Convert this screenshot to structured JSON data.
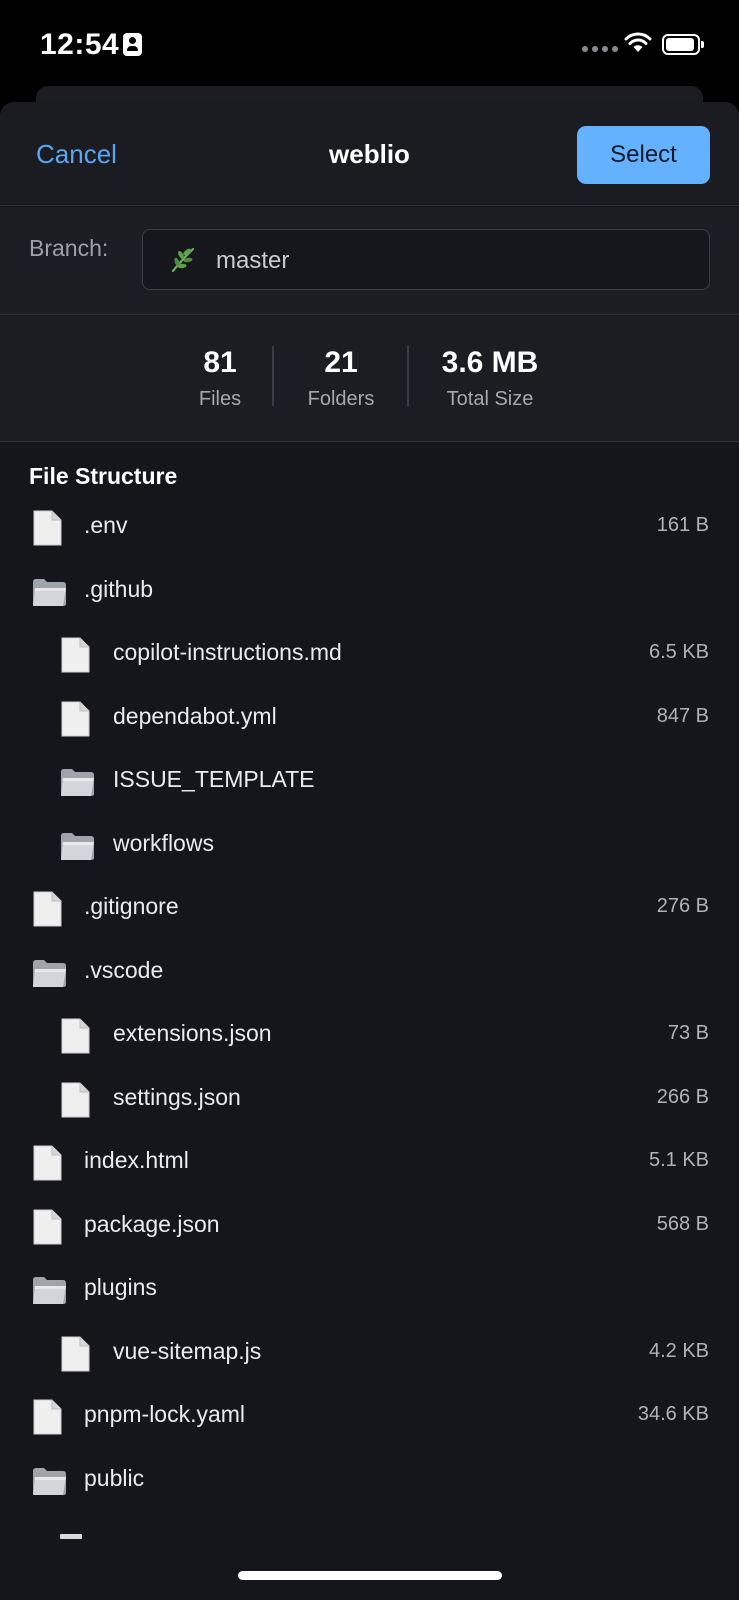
{
  "status_bar": {
    "time": "12:54"
  },
  "nav": {
    "cancel_label": "Cancel",
    "title": "weblio",
    "select_label": "Select"
  },
  "branch": {
    "label": "Branch:",
    "value": "master"
  },
  "stats": {
    "files": {
      "value": "81",
      "label": "Files"
    },
    "folders": {
      "value": "21",
      "label": "Folders"
    },
    "size": {
      "value": "3.6 MB",
      "label": "Total Size"
    }
  },
  "file_structure": {
    "title": "File Structure",
    "items": [
      {
        "type": "file",
        "level": 0,
        "name": ".env",
        "size": "161 B"
      },
      {
        "type": "folder",
        "level": 0,
        "name": ".github",
        "size": ""
      },
      {
        "type": "file",
        "level": 1,
        "name": "copilot-instructions.md",
        "size": "6.5 KB"
      },
      {
        "type": "file",
        "level": 1,
        "name": "dependabot.yml",
        "size": "847 B"
      },
      {
        "type": "folder",
        "level": 1,
        "name": "ISSUE_TEMPLATE",
        "size": ""
      },
      {
        "type": "folder",
        "level": 1,
        "name": "workflows",
        "size": ""
      },
      {
        "type": "file",
        "level": 0,
        "name": ".gitignore",
        "size": "276 B"
      },
      {
        "type": "folder",
        "level": 0,
        "name": ".vscode",
        "size": ""
      },
      {
        "type": "file",
        "level": 1,
        "name": "extensions.json",
        "size": "73 B"
      },
      {
        "type": "file",
        "level": 1,
        "name": "settings.json",
        "size": "266 B"
      },
      {
        "type": "file",
        "level": 0,
        "name": "index.html",
        "size": "5.1 KB"
      },
      {
        "type": "file",
        "level": 0,
        "name": "package.json",
        "size": "568 B"
      },
      {
        "type": "folder",
        "level": 0,
        "name": "plugins",
        "size": ""
      },
      {
        "type": "file",
        "level": 1,
        "name": "vue-sitemap.js",
        "size": "4.2 KB"
      },
      {
        "type": "file",
        "level": 0,
        "name": "pnpm-lock.yaml",
        "size": "34.6 KB"
      },
      {
        "type": "folder",
        "level": 0,
        "name": "public",
        "size": ""
      }
    ]
  },
  "colors": {
    "accent": "#64b2ff",
    "link": "#5aa5f2",
    "background": "#14161b",
    "panel": "#1b1d23"
  },
  "icons": {
    "file": "document-icon",
    "folder": "folder-icon",
    "branch": "leaf-icon"
  }
}
